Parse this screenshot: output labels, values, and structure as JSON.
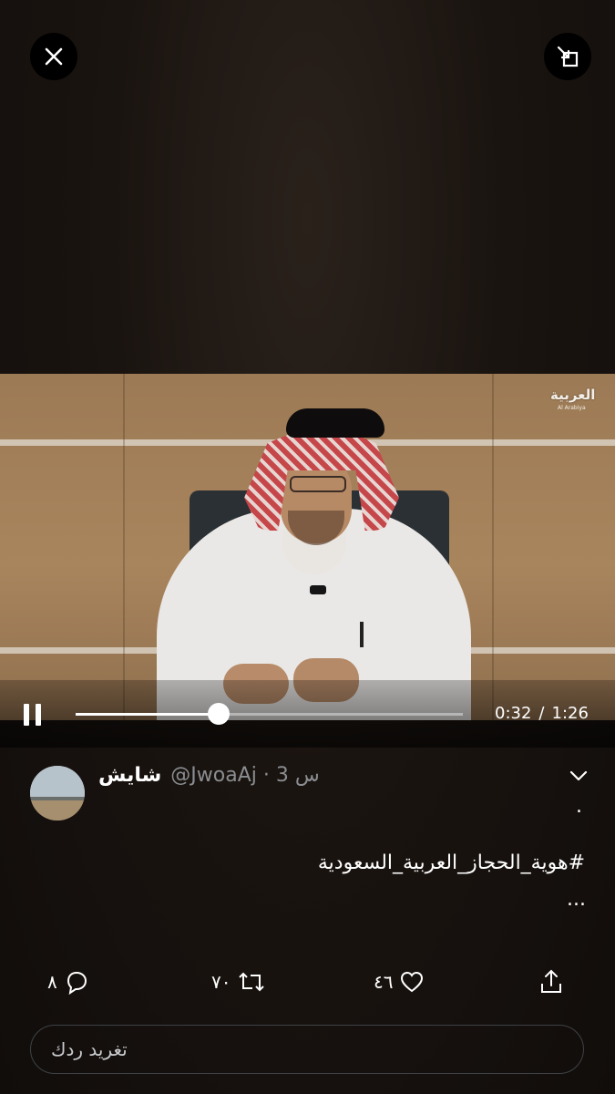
{
  "video": {
    "channel_logo": "العربية",
    "channel_logo_sub": "Al Arabiya",
    "progress": 0.37,
    "current_time": "0:32",
    "separator": "/",
    "duration": "1:26"
  },
  "icons": {
    "close": "close-icon",
    "minimize": "minimize-icon",
    "pause": "pause-icon",
    "chevron": "chevron-down-icon",
    "reply": "reply-icon",
    "retweet": "retweet-icon",
    "like": "heart-icon",
    "share": "share-icon"
  },
  "tweet": {
    "display_name": "شايش",
    "handle_time": "@JwoaAj · 3 س",
    "dot": ".",
    "hashtag": "#هوية_الحجاز_العربية_السعودية",
    "ellipsis": "...",
    "reply_count": "٨",
    "retweet_count": "٧٠",
    "like_count": "٤٦"
  },
  "reply_box": {
    "placeholder": "تغريد ردك"
  },
  "colors": {
    "background": "#140f0c",
    "text": "#ffffff",
    "muted": "#8a8d91"
  }
}
